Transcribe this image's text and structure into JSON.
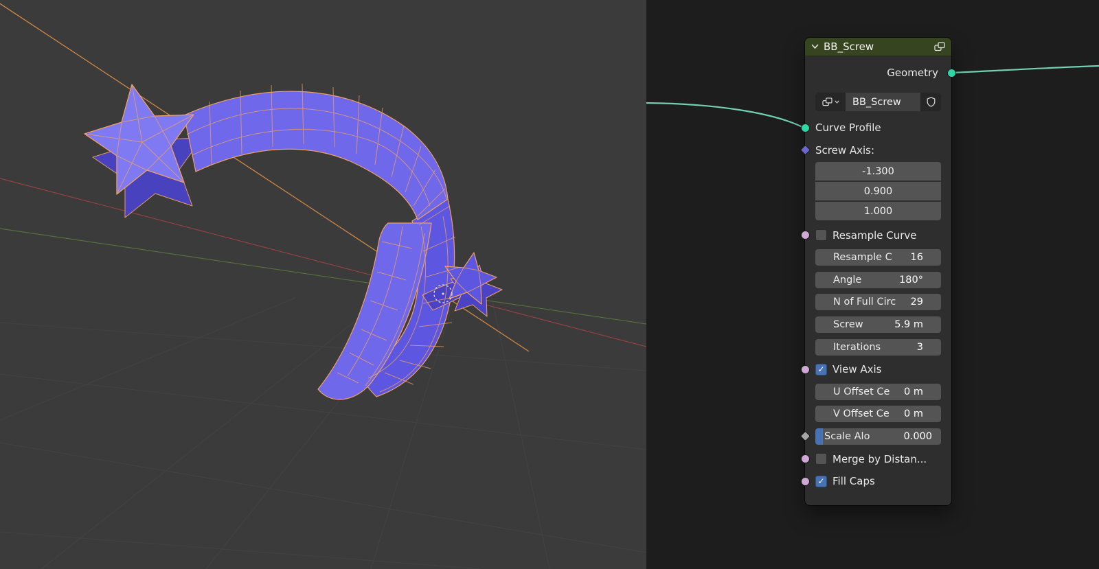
{
  "colors": {
    "viewport-bg": "#3b3b3b",
    "grid": "#484848",
    "axis-x": "#9e4343",
    "axis-y": "#5d7c41",
    "axis-screw": "#d08844",
    "mesh-fill": "#6f68ea",
    "mesh-mid": "#5d56e0",
    "mesh-dark": "#4a43c6",
    "mesh-light": "#807af2",
    "mesh-wire": "#efa163",
    "cursor": "#e6e6e6",
    "editor-bg": "#1d1d1d",
    "node-header": "#36451f",
    "node-body": "#2e2e2e",
    "field": "#545454",
    "text": "#e8e8e8",
    "checkbox-blue": "#4772b3",
    "socket-geometry": "#2fd6a6",
    "selector-bg": "#262626",
    "selector-name-bg": "#404040"
  },
  "viewport": {
    "content": "star-profile mesh swept along screw path, edit-mode wireframe",
    "cursor_marker": "dashed rotation-center circle"
  },
  "node_editor": {
    "wire_color": "#72d0b4",
    "node": {
      "title": "BB_Screw",
      "header_icons": [
        "chevron-down",
        "node-group"
      ],
      "output_label": "Geometry",
      "group_name": "BB_Screw",
      "group_selector_icons": [
        "node-tree-dropdown",
        "fake-user-shield"
      ],
      "rows": [
        {
          "type": "input",
          "label": "Curve Profile",
          "socket": {
            "shape": "circle",
            "color": "#2fd6a6"
          }
        },
        {
          "type": "label",
          "label": "Screw Axis:",
          "socket": {
            "shape": "diamond",
            "color": "#6a68cc"
          }
        },
        {
          "type": "vector",
          "values": [
            "-1.300",
            "0.900",
            "1.000"
          ]
        },
        {
          "type": "checkbox",
          "label": "Resample Curve",
          "checked": false,
          "socket": {
            "shape": "circle",
            "color": "#cfa8d5"
          }
        },
        {
          "type": "field",
          "label": "Resample C",
          "value": "16",
          "socket": {
            "shape": "diamond",
            "color": "#5a9e61"
          }
        },
        {
          "type": "field",
          "label": "Angle",
          "value": "180°",
          "socket": {
            "shape": "circle",
            "color": "#a6a6a6"
          }
        },
        {
          "type": "field",
          "label": "N of Full Circ",
          "value": "29",
          "socket": {
            "shape": "circle",
            "color": "#5a9e61"
          }
        },
        {
          "type": "field",
          "label": "Screw",
          "value": "5.9 m",
          "socket": {
            "shape": "diamond",
            "color": "#a6a6a6"
          }
        },
        {
          "type": "field",
          "label": "Iterations",
          "value": "3",
          "socket": {
            "shape": "circle",
            "color": "#5a9e61"
          }
        },
        {
          "type": "checkbox",
          "label": "View Axis",
          "checked": true,
          "socket": {
            "shape": "circle",
            "color": "#cfa8d5"
          }
        },
        {
          "type": "field",
          "label": "U Offset Ce",
          "value": "0 m",
          "socket": {
            "shape": "circle",
            "color": "#a6a6a6"
          }
        },
        {
          "type": "field",
          "label": "V Offset Ce",
          "value": "0 m",
          "socket": {
            "shape": "circle",
            "color": "#a6a6a6"
          }
        },
        {
          "type": "slider",
          "label": "Scale Alo",
          "value": "0.000",
          "fill": 0.06,
          "socket": {
            "shape": "diamond",
            "color": "#a6a6a6"
          }
        },
        {
          "type": "checkbox",
          "label": "Merge by Distan...",
          "checked": false,
          "socket": {
            "shape": "circle",
            "color": "#cfa8d5"
          }
        },
        {
          "type": "checkbox",
          "label": "Fill Caps",
          "checked": true,
          "socket": {
            "shape": "circle",
            "color": "#cfa8d5"
          }
        }
      ]
    }
  }
}
